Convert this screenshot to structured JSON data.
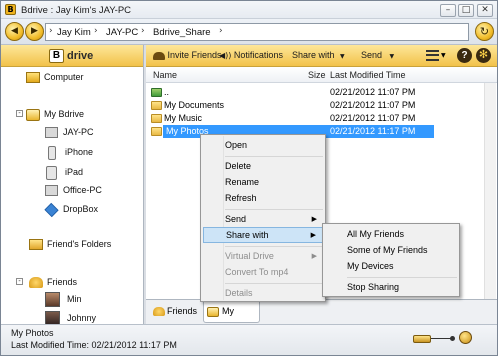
{
  "window": {
    "title": "Bdrive : Jay Kim's JAY-PC",
    "minimize_icon": "minimize-icon",
    "maximize_icon": "maximize-icon",
    "close_icon": "close-icon"
  },
  "address": {
    "crumbs": [
      "Jay Kim",
      "JAY-PC",
      "Bdrive_Share"
    ]
  },
  "brand": {
    "letter": "B",
    "name": "drive"
  },
  "tree": {
    "computer": "Computer",
    "my_bdrive": "My Bdrive",
    "jay_pc": "JAY-PC",
    "iphone": "iPhone",
    "ipad": "iPad",
    "office_pc": "Office-PC",
    "dropbox": "DropBox",
    "friends_folders": "Friend's Folders",
    "friends": "Friends",
    "min": "Min",
    "johnny": "Johnny"
  },
  "toolbar": {
    "invite": "Invite Friends",
    "notifications": "Notifications",
    "share_with": "Share with",
    "send": "Send"
  },
  "columns": {
    "name": "Name",
    "size": "Size",
    "modified": "Last Modified Time"
  },
  "files": [
    {
      "name": "..",
      "date": "02/21/2012 11:07 PM"
    },
    {
      "name": "My Documents",
      "date": "02/21/2012 11:07 PM"
    },
    {
      "name": "My Music",
      "date": "02/21/2012 11:07 PM"
    },
    {
      "name": "My Photos",
      "date": "02/21/2012 11:17 PM"
    }
  ],
  "context_menu": {
    "open": "Open",
    "delete": "Delete",
    "rename": "Rename",
    "refresh": "Refresh",
    "send": "Send",
    "share_with": "Share with",
    "virtual_drive": "Virtual Drive",
    "convert": "Convert To mp4",
    "details": "Details"
  },
  "submenu": {
    "all": "All My Friends",
    "some": "Some of My Friends",
    "devices": "My Devices",
    "stop": "Stop Sharing"
  },
  "tabs": {
    "friends": "Friends",
    "my_bdrive": "My Bdrive"
  },
  "status": {
    "name": "My Photos",
    "modified": "Last Modified Time: 02/21/2012 11:17 PM"
  },
  "colors": {
    "accent": "#f2c24a",
    "selection": "#3399ff"
  }
}
